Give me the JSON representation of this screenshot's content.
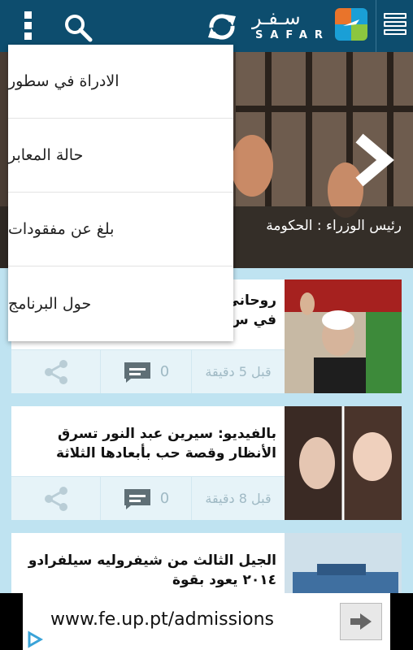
{
  "app": {
    "logo_ar": "سـفـر",
    "logo_en": "SAFAR"
  },
  "hero": {
    "caption": "رئيس الوزراء : الحكومة"
  },
  "menu": {
    "items": [
      {
        "label": "الادراة في سطور"
      },
      {
        "label": "حالة المعابر"
      },
      {
        "label": "بلغ عن مفقودات"
      },
      {
        "label": "حول البرنامج"
      }
    ]
  },
  "articles": [
    {
      "title": "روحاني\nفي س",
      "comments": "0",
      "time": "قبل 5 دقيقة"
    },
    {
      "title": "بالفيديو: سيرين عبد النور تسرق الأنظار وقصة حب بأبعادها الثلاثة",
      "comments": "0",
      "time": "قبل 8 دقيقة"
    },
    {
      "title": "الجيل الثالث من شيفروليه سيلفرادو ٢٠١٤ يعود بقوة",
      "comments": "",
      "time": ""
    }
  ],
  "ad": {
    "url": "www.fe.up.pt/admissions"
  },
  "colors": {
    "topbar": "#0d4d6e",
    "background": "#bfe3f1",
    "footer_tint": "#e6f3f8",
    "muted": "#9fb9c4"
  }
}
